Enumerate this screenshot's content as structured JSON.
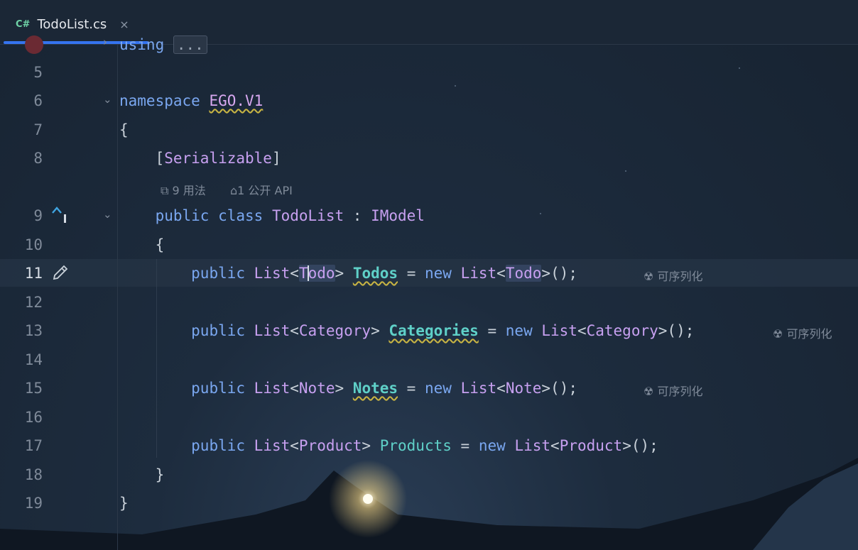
{
  "tab": {
    "icon": "C#",
    "title": "TodoList.cs",
    "close": "×"
  },
  "lines": {
    "n5": "5",
    "n6": "6",
    "n7": "7",
    "n8": "8",
    "n9": "9",
    "n10": "10",
    "n11": "11",
    "n12": "12",
    "n13": "13",
    "n14": "14",
    "n15": "15",
    "n16": "16",
    "n17": "17",
    "n18": "18",
    "n19": "19"
  },
  "code": {
    "using_kw": "using",
    "using_fold": "...",
    "namespace_kw": "namespace",
    "namespace_name": "EGO.V1",
    "brace_open": "{",
    "brace_close": "}",
    "attr_open": "[",
    "attr_name": "Serializable",
    "attr_close": "]",
    "public": "public",
    "class": "class",
    "new": "new",
    "class_name": "TodoList",
    "colon": ":",
    "interface": "IModel",
    "list": "List",
    "lt": "<",
    "gt": ">",
    "todo": "Todo",
    "todos": "Todos",
    "category": "Category",
    "categories": "Categories",
    "note": "Note",
    "notes": "Notes",
    "product": "Product",
    "products": "Products",
    "eq": "=",
    "ctor_end": "();"
  },
  "hints": {
    "usages": "9 用法",
    "public_api": "1 公开 API",
    "serializable": "可序列化"
  },
  "gutter_icons": [
    "breakpoint-icon",
    "implements-icon",
    "edit-pencil-icon",
    "fold-chevron-icon"
  ]
}
